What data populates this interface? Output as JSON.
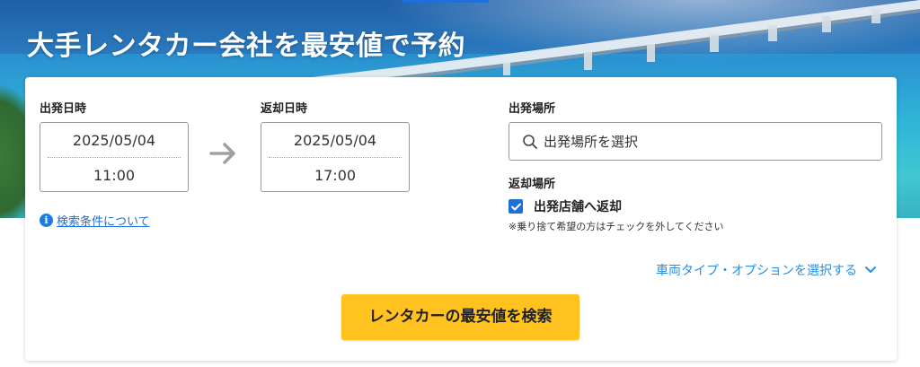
{
  "hero": {
    "title": "大手レンタカー会社を最安値で予約"
  },
  "departure": {
    "label": "出発日時",
    "date": "2025/05/04",
    "time": "11:00"
  },
  "return": {
    "label": "返却日時",
    "date": "2025/05/04",
    "time": "17:00"
  },
  "info_link": {
    "text": "検索条件について"
  },
  "pickup": {
    "label": "出発場所",
    "placeholder": "出発場所を選択"
  },
  "dropoff": {
    "label": "返却場所",
    "checkbox_label": "出発店舗へ返却",
    "checked": true,
    "note": "※乗り捨て希望の方はチェックを外してください"
  },
  "options": {
    "link_text": "車両タイプ・オプションを選択する"
  },
  "submit": {
    "label": "レンタカーの最安値を検索"
  },
  "colors": {
    "accent_blue": "#1e6fd9",
    "button_yellow": "#ffc21f",
    "link_blue": "#2a8fe0"
  },
  "icons": {
    "arrow": "arrow-right-icon",
    "info": "info-icon",
    "search": "search-icon",
    "check": "check-icon",
    "chevron": "chevron-down-icon"
  }
}
